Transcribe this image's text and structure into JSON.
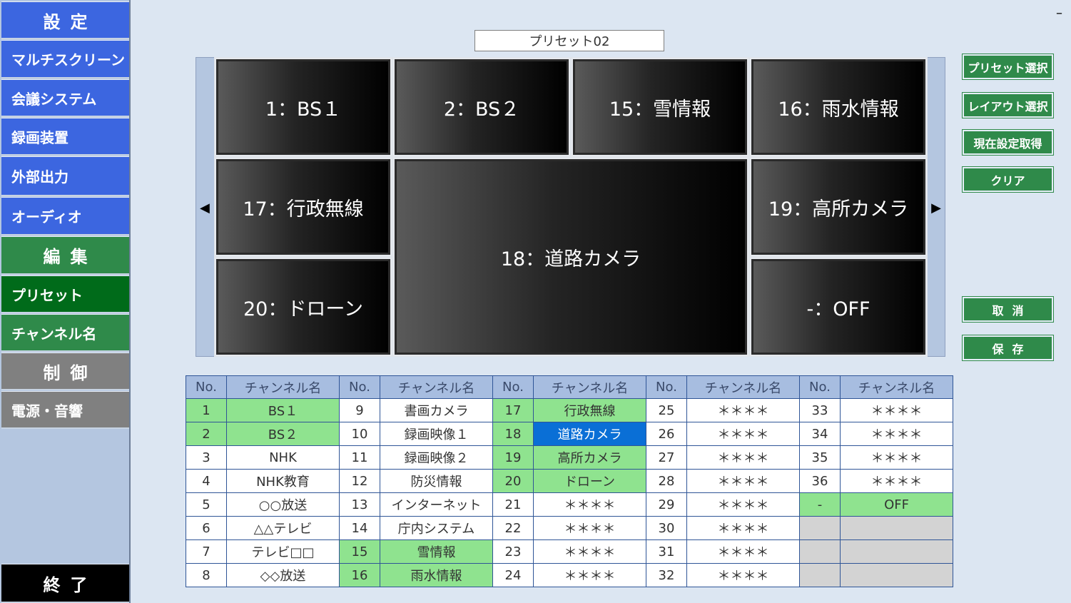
{
  "sidebar": {
    "settings_header": "設定",
    "multi_screen": "マルチスクリーン",
    "conference": "会議システム",
    "recorder": "録画装置",
    "external_output": "外部出力",
    "audio": "オーディオ",
    "edit_header": "編集",
    "preset": "プリセット",
    "channel_name": "チャンネル名",
    "control_header": "制御",
    "power_sound": "電源・音響",
    "exit": "終了"
  },
  "window": {
    "minimize": "–"
  },
  "preset_title": "プリセット02",
  "nav": {
    "left_arrow": "◀",
    "right_arrow": "▶"
  },
  "screens": [
    "1：BS１",
    "2：BS２",
    "15：雪情報",
    "16：雨水情報",
    "17：行政無線",
    "18：道路カメラ",
    "19：高所カメラ",
    "20：ドローン",
    "-：OFF"
  ],
  "buttons": {
    "preset_select": "プリセット選択",
    "layout_select": "レイアウト選択",
    "get_current": "現在設定取得",
    "clear": "クリア",
    "cancel": "取消",
    "save": "保存"
  },
  "table": {
    "header_no": "No.",
    "header_name": "チャンネル名",
    "rows": [
      [
        [
          "1",
          "BS１"
        ],
        [
          "9",
          "書画カメラ"
        ],
        [
          "17",
          "行政無線"
        ],
        [
          "25",
          "＊＊＊＊"
        ],
        [
          "33",
          "＊＊＊＊"
        ]
      ],
      [
        [
          "2",
          "BS２"
        ],
        [
          "10",
          "録画映像１"
        ],
        [
          "18",
          "道路カメラ"
        ],
        [
          "26",
          "＊＊＊＊"
        ],
        [
          "34",
          "＊＊＊＊"
        ]
      ],
      [
        [
          "3",
          "NHK"
        ],
        [
          "11",
          "録画映像２"
        ],
        [
          "19",
          "高所カメラ"
        ],
        [
          "27",
          "＊＊＊＊"
        ],
        [
          "35",
          "＊＊＊＊"
        ]
      ],
      [
        [
          "4",
          "NHK教育"
        ],
        [
          "12",
          "防災情報"
        ],
        [
          "20",
          "ドローン"
        ],
        [
          "28",
          "＊＊＊＊"
        ],
        [
          "36",
          "＊＊＊＊"
        ]
      ],
      [
        [
          "5",
          "○○放送"
        ],
        [
          "13",
          "インターネット"
        ],
        [
          "21",
          "＊＊＊＊"
        ],
        [
          "29",
          "＊＊＊＊"
        ],
        [
          "-",
          "OFF"
        ]
      ],
      [
        [
          "6",
          "△△テレビ"
        ],
        [
          "14",
          "庁内システム"
        ],
        [
          "22",
          "＊＊＊＊"
        ],
        [
          "30",
          "＊＊＊＊"
        ],
        [
          "",
          ""
        ]
      ],
      [
        [
          "7",
          "テレビ□□"
        ],
        [
          "15",
          "雪情報"
        ],
        [
          "23",
          "＊＊＊＊"
        ],
        [
          "31",
          "＊＊＊＊"
        ],
        [
          "",
          ""
        ]
      ],
      [
        [
          "8",
          "◇◇放送"
        ],
        [
          "16",
          "雨水情報"
        ],
        [
          "24",
          "＊＊＊＊"
        ],
        [
          "32",
          "＊＊＊＊"
        ],
        [
          "",
          ""
        ]
      ]
    ]
  }
}
